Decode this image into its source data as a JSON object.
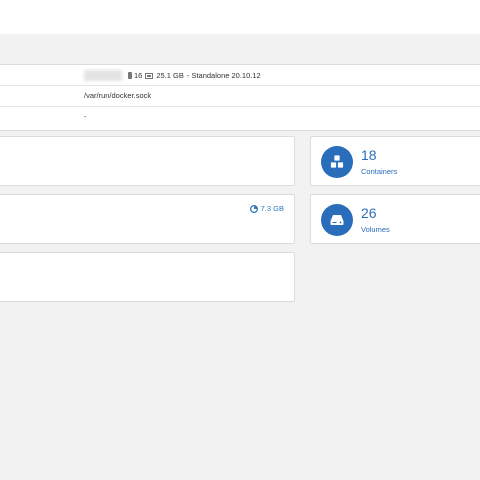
{
  "endpoint_info": {
    "cpu_count": "16",
    "memory": "25.1 GB",
    "mode": "- Standalone 20.10.12",
    "url": "/var/run/docker.sock",
    "tags": "-"
  },
  "panels": {
    "images_disk": "7.3 GB"
  },
  "stats": {
    "containers": {
      "count": "18",
      "label": "Containers",
      "icon": "cubes-icon"
    },
    "volumes": {
      "count": "26",
      "label": "Volumes",
      "icon": "hdd-icon"
    }
  },
  "colors": {
    "accent": "#2a6ebb",
    "link": "#337ab7",
    "background": "#f2f2f2"
  }
}
